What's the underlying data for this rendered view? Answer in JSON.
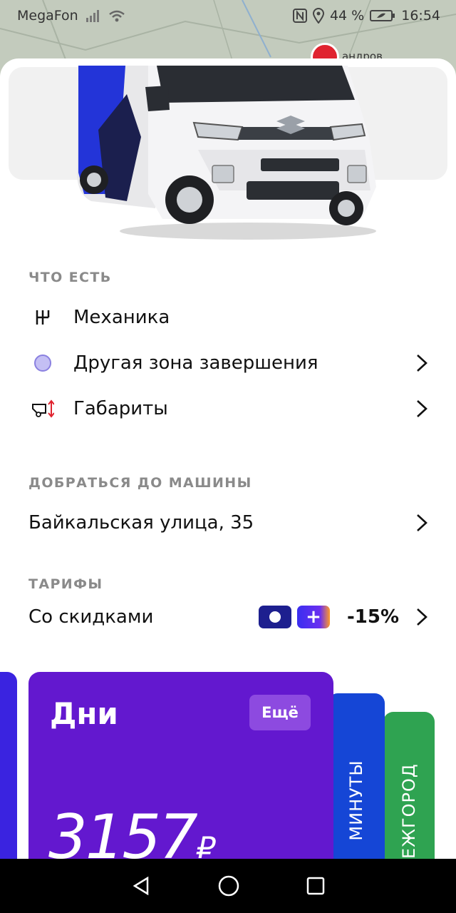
{
  "status": {
    "carrier": "MegaFon",
    "battery": "44 %",
    "time": "16:54"
  },
  "map": {
    "label": "андров"
  },
  "features": {
    "title": "ЧТО ЕСТЬ",
    "items": [
      {
        "label": "Механика"
      },
      {
        "label": "Другая зона завершения"
      },
      {
        "label": "Габариты"
      }
    ]
  },
  "route": {
    "title": "ДОБРАТЬСЯ ДО МАШИНЫ",
    "address": "Байкальская улица, 35"
  },
  "tariffs": {
    "title": "ТАРИФЫ",
    "discount_label": "Со скидками",
    "plus_symbol": "+",
    "discount": "-15%",
    "cards": {
      "main": {
        "name": "Дни",
        "more": "Ещё",
        "price": "3157",
        "currency": "₽"
      },
      "minutes": "МИНУТЫ",
      "intercity": "МЕЖГОРОД"
    }
  },
  "colors": {
    "accent_purple": "#6318CF",
    "blue": "#1546D6",
    "green": "#2FA351"
  },
  "icons": [
    "signal-icon",
    "wifi-icon",
    "nfc-icon",
    "location-icon",
    "battery-icon",
    "gearbox-icon",
    "zone-dot-icon",
    "dimensions-icon",
    "chevron-right-icon",
    "back-icon",
    "home-icon",
    "recents-icon"
  ]
}
